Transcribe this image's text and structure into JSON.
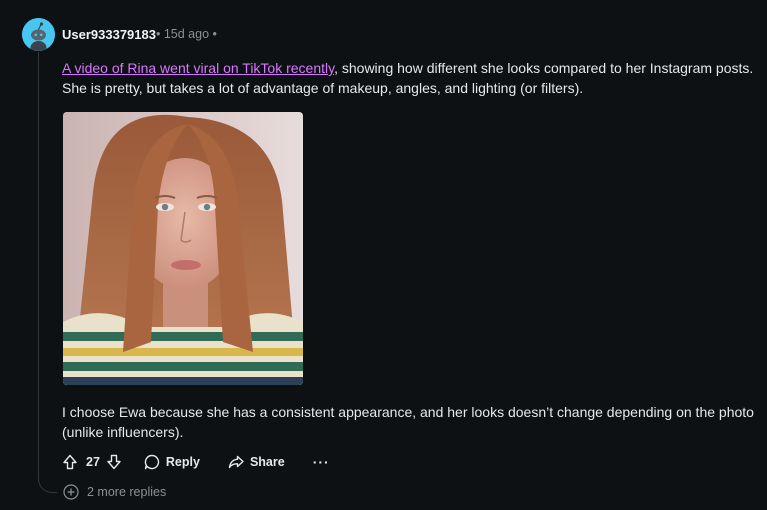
{
  "comment": {
    "author": "User933379183",
    "meta": "• 15d ago •",
    "link_text": "A video of Rina went viral on TikTok recently",
    "paragraph1_rest": ", showing how different she looks compared to her Instagram posts. She is pretty, but takes a lot of advantage of makeup, angles, and lighting (or filters).",
    "paragraph2": "I choose Ewa because she has a consistent appearance, and her looks doesn’t change depending on the photo (unlike influencers).",
    "image_alt": "Young woman with long auburn hair wearing a striped sweater"
  },
  "actions": {
    "vote_count": "27",
    "reply_label": "Reply",
    "share_label": "Share",
    "more_label": "···"
  },
  "more_replies": "2 more replies",
  "colors": {
    "background": "#0e1113",
    "link": "#d777ff",
    "avatar": "#48c6f2",
    "muted": "#8a9094"
  },
  "icons": [
    "avatar-icon",
    "upvote-icon",
    "downvote-icon",
    "comment-icon",
    "share-icon",
    "more-icon",
    "plus-circle-icon"
  ]
}
